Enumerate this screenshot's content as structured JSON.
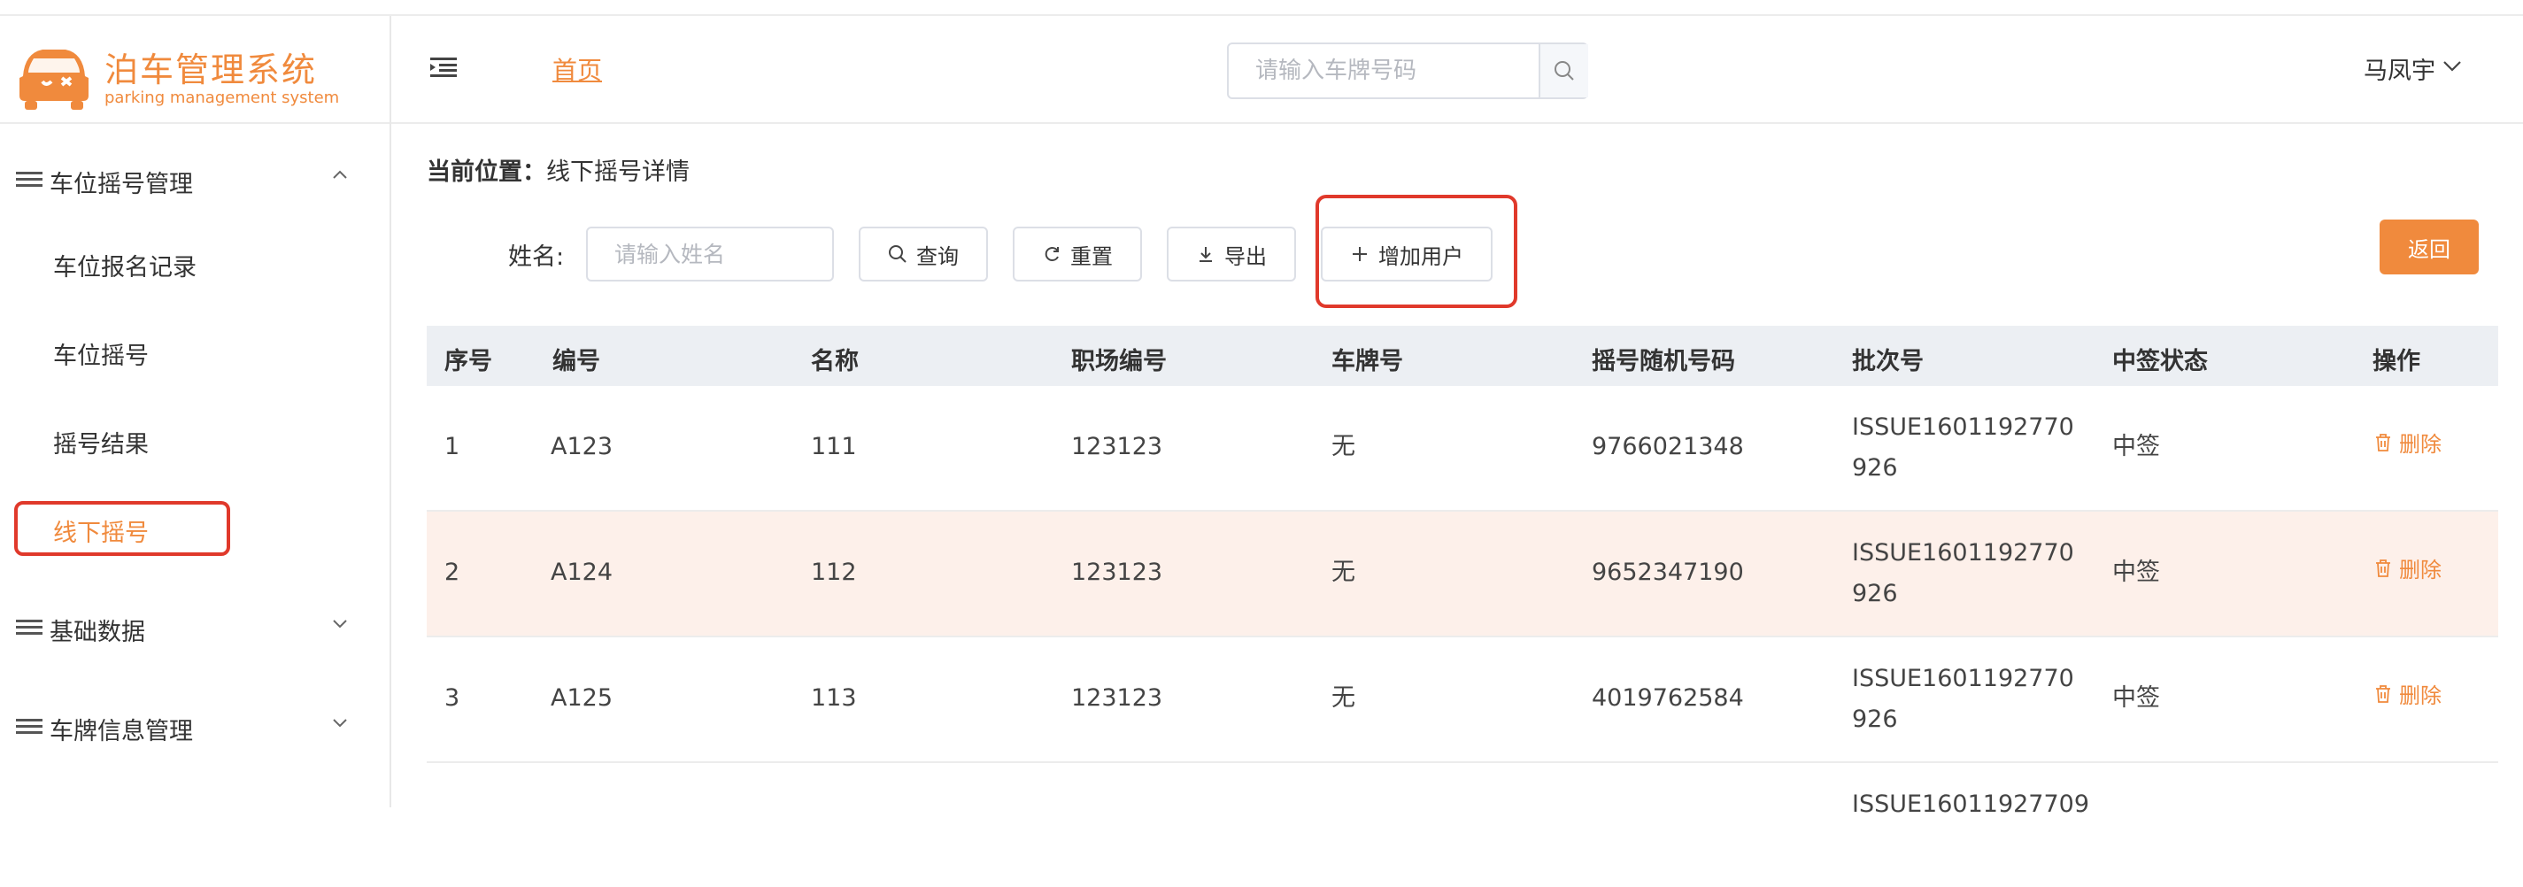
{
  "app": {
    "title": "泊车管理系统",
    "subtitle": "parking management system"
  },
  "sidebar": {
    "groups": [
      {
        "label": "车位摇号管理",
        "expanded": true,
        "items": [
          {
            "label": "车位报名记录"
          },
          {
            "label": "车位摇号"
          },
          {
            "label": "摇号结果"
          },
          {
            "label": "线下摇号",
            "active": true
          }
        ]
      },
      {
        "label": "基础数据",
        "expanded": false
      },
      {
        "label": "车牌信息管理",
        "expanded": false
      }
    ]
  },
  "header": {
    "home_link": "首页",
    "search_placeholder": "请输入车牌号码",
    "user_name": "马凤宇"
  },
  "breadcrumb": {
    "label": "当前位置：",
    "value": "线下摇号详情"
  },
  "filter": {
    "name_label": "姓名:",
    "name_placeholder": "请输入姓名",
    "query_label": "查询",
    "reset_label": "重置",
    "export_label": "导出",
    "add_user_label": "增加用户",
    "back_label": "返回"
  },
  "table": {
    "columns": [
      "序号",
      "编号",
      "名称",
      "职场编号",
      "车牌号",
      "摇号随机号码",
      "批次号",
      "中签状态",
      "操作"
    ],
    "rows": [
      {
        "index": "1",
        "code": "A123",
        "name": "111",
        "site": "123123",
        "plate": "无",
        "random": "9766021348",
        "batch": "ISSUE1601192770926",
        "status": "中签",
        "action": "删除"
      },
      {
        "index": "2",
        "code": "A124",
        "name": "112",
        "site": "123123",
        "plate": "无",
        "random": "9652347190",
        "batch": "ISSUE1601192770926",
        "status": "中签",
        "action": "删除"
      },
      {
        "index": "3",
        "code": "A125",
        "name": "113",
        "site": "123123",
        "plate": "无",
        "random": "4019762584",
        "batch": "ISSUE1601192770926",
        "status": "中签",
        "action": "删除"
      },
      {
        "batch": "ISSUE16011927709"
      }
    ]
  },
  "colors": {
    "accent": "#f08a3d",
    "highlight_box": "#e0392b",
    "row_highlight": "#fdf0ea"
  }
}
